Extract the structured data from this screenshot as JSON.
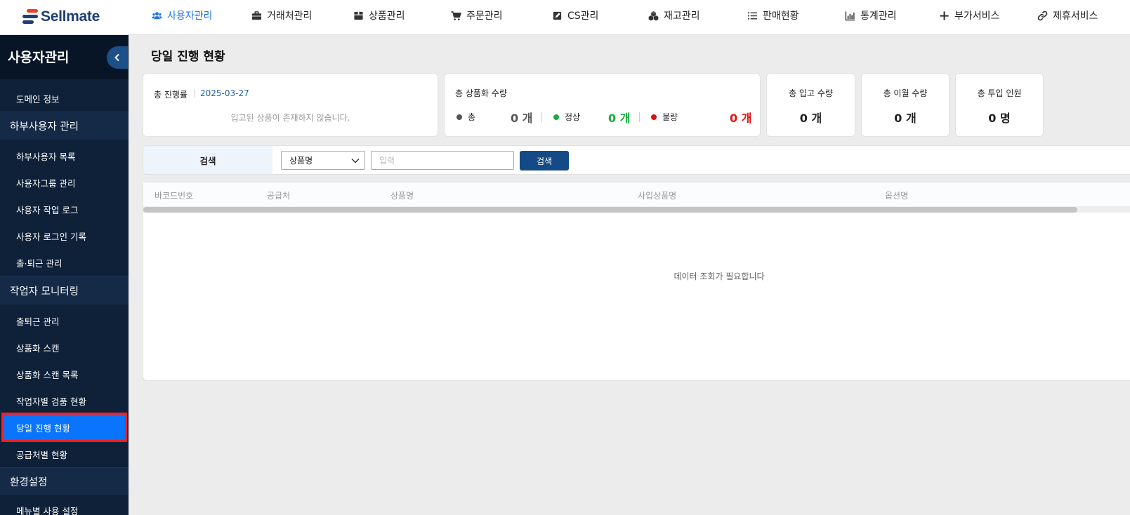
{
  "brand": {
    "name": "Sellmate"
  },
  "topnav": [
    {
      "label": "사용자관리",
      "icon": "users-icon",
      "active": true
    },
    {
      "label": "거래처관리",
      "icon": "briefcase-icon",
      "active": false
    },
    {
      "label": "상품관리",
      "icon": "box-icon",
      "active": false
    },
    {
      "label": "주문관리",
      "icon": "cart-icon",
      "active": false
    },
    {
      "label": "CS관리",
      "icon": "edit-square-icon",
      "active": false
    },
    {
      "label": "재고관리",
      "icon": "boxes-icon",
      "active": false
    },
    {
      "label": "판매현황",
      "icon": "list-icon",
      "active": false
    },
    {
      "label": "통계관리",
      "icon": "bar-chart-icon",
      "active": false
    },
    {
      "label": "부가서비스",
      "icon": "plus-icon",
      "active": false
    },
    {
      "label": "제휴서비스",
      "icon": "link-icon",
      "active": false
    }
  ],
  "sidebar": {
    "title": "사용자관리",
    "items": [
      {
        "type": "item",
        "label": "도메인 정보"
      },
      {
        "type": "group",
        "label": "하부사용자 관리"
      },
      {
        "type": "item",
        "label": "하부사용자 목록"
      },
      {
        "type": "item",
        "label": "사용자그룹 관리"
      },
      {
        "type": "item",
        "label": "사용자 작업 로그"
      },
      {
        "type": "item",
        "label": "사용자 로그인 기록"
      },
      {
        "type": "item",
        "label": "출·퇴근 관리"
      },
      {
        "type": "group",
        "label": "작업자 모니터링"
      },
      {
        "type": "item",
        "label": "출퇴근 관리"
      },
      {
        "type": "item",
        "label": "상품화 스캔"
      },
      {
        "type": "item",
        "label": "상품화 스캔 목록"
      },
      {
        "type": "item",
        "label": "작업자별 검품 현황"
      },
      {
        "type": "item",
        "label": "당일 진행 현황",
        "selected": true
      },
      {
        "type": "item",
        "label": "공급처별 현황"
      },
      {
        "type": "group",
        "label": "환경설정"
      },
      {
        "type": "item",
        "label": "메뉴별 사용 설정"
      }
    ]
  },
  "main": {
    "title": "당일 진행 현황",
    "progress_card": {
      "label": "총 진행률",
      "date": "2025-03-27",
      "empty_text": "입고된 상품이 존재하지 않습니다."
    },
    "commercialize_card": {
      "label": "총 상품화 수량",
      "total_label": "총",
      "total_value": "0 개",
      "normal_label": "정상",
      "normal_value": "0 개",
      "defect_label": "불량",
      "defect_value": "0 개"
    },
    "stat_cards": [
      {
        "label": "총 입고 수량",
        "value": "0 개"
      },
      {
        "label": "총 이월 수량",
        "value": "0 개"
      },
      {
        "label": "총 투입 인원",
        "value": "0 명"
      }
    ],
    "search": {
      "label": "검색",
      "select_value": "상품명",
      "input_placeholder": "입력",
      "button_label": "검색"
    },
    "grid": {
      "columns": [
        "바코드번호",
        "공급처",
        "상품명",
        "사입상품명",
        "옵션명"
      ],
      "empty_text": "데이터 조회가 필요합니다"
    }
  },
  "colors": {
    "accent": "#1a73e8",
    "sidebar_bg": "#0e2139",
    "selected": "#0a74ff",
    "normal": "#1aab40",
    "defect": "#e01010",
    "button": "#144a86"
  }
}
